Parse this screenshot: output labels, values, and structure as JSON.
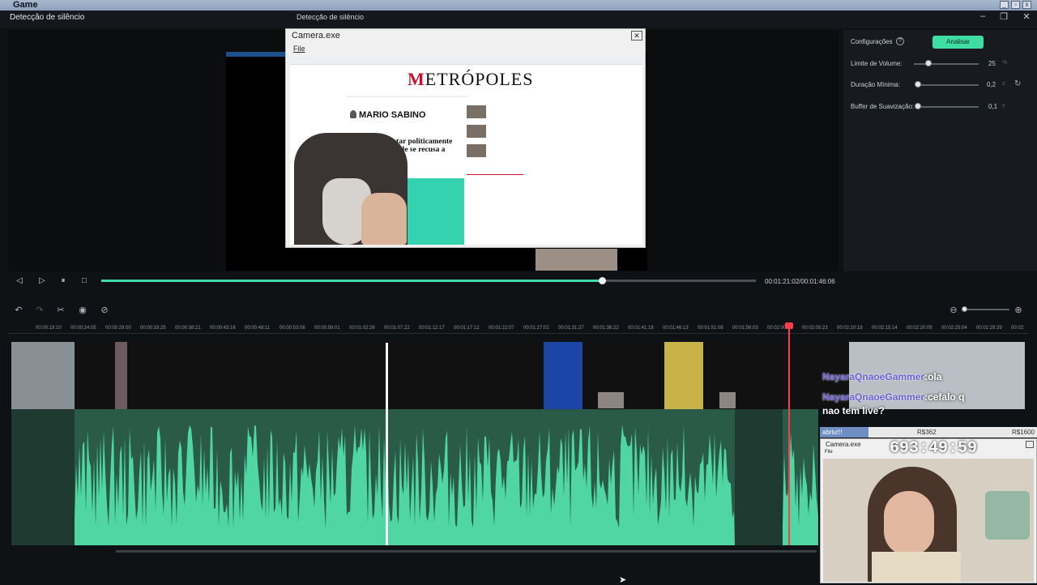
{
  "os": {
    "title": "Game"
  },
  "app": {
    "title": "Detecção de silêncio",
    "center_title": "Detecção de silêncio"
  },
  "camera": {
    "title": "Camera.exe",
    "menu_file": "File",
    "close": "✕"
  },
  "site": {
    "logo": "ETRÓPOLES",
    "logo_m": "M",
    "author": "MARIO SABINO",
    "headline": "O STF quis matar politicamente Bolsonaro, mas ele se recusa a morrer"
  },
  "panel": {
    "config_label": "Configurações",
    "help": "?",
    "analyze_button": "Analisar",
    "params": [
      {
        "label": "Limite de Volume:",
        "value": "25",
        "unit": "%",
        "level": 0.22
      },
      {
        "label": "Duração Mínima:",
        "value": "0,2",
        "unit": "s",
        "level": 0.0
      },
      {
        "label": "Buffer de Suavização:",
        "value": "0,1",
        "unit": "s",
        "level": 0.0
      }
    ]
  },
  "player": {
    "timecode": "00:01:21:02/00:01:46:06",
    "progress": 0.765
  },
  "ruler": [
    "00:00:19:10",
    "00:00:24:05",
    "00:00:29:00",
    "00:00:33:25",
    "00:00:38:21",
    "00:00:43:16",
    "00:00:48:11",
    "00:00:53:06",
    "00:00:58:01",
    "00:01:02:26",
    "00:01:07:22",
    "00:01:12:17",
    "00:01:17:12",
    "00:01:22:07",
    "00:01:27:02",
    "00:01:31:27",
    "00:01:36:22",
    "00:01:41:18",
    "00:01:46:13",
    "00:01:51:08",
    "00:01:56:03",
    "00:02:00:28",
    "00:02:05:23",
    "00:02:10:18",
    "00:02:15:14",
    "00:02:20:09",
    "00:02:25:04",
    "00:02:29:29",
    "00:02:"
  ],
  "overlay": {
    "chat": [
      {
        "user": "NayaraQnaoeGammer",
        "msg": ":ola"
      },
      {
        "user": "NayaraQnaoeGammer",
        "msg": ":cefalo q"
      }
    ],
    "chat_tail": "nao tem live?",
    "donation_left": "abriu!!!",
    "donation_mid": "R$362",
    "donation_right": "R$1600",
    "cam_title": "Camera.exe",
    "cam_menu": "File",
    "timer": "693:49:59"
  },
  "icons": {
    "undo": "↶",
    "redo": "↷",
    "cut": "✂",
    "eye": "◉",
    "eye_off": "⊘",
    "prev": "◁",
    "play": "▷",
    "pause": "⏸",
    "stop": "□",
    "zoom_out": "⊖",
    "zoom_in": "⊕",
    "refresh": "↻",
    "minimize": "–",
    "maximize": "❐",
    "close": "✕"
  },
  "colors": {
    "accent": "#3fdca6",
    "playhead": "#ff3b4e",
    "waveform": "#4fd6a3"
  }
}
